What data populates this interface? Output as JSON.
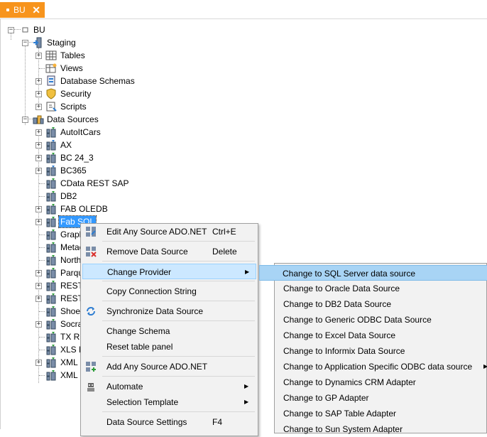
{
  "tab": {
    "label": "BU",
    "close": "✕",
    "color": "#f7941d"
  },
  "tree": {
    "root": "BU",
    "staging": {
      "label": "Staging",
      "children": [
        "Tables",
        "Views",
        "Database Schemas",
        "Security",
        "Scripts"
      ]
    },
    "datasources": {
      "label": "Data Sources",
      "children": [
        "AutoItCars",
        "AX",
        "BC 24_3",
        "BC365",
        "CData REST SAP",
        "DB2",
        "FAB OLEDB",
        "Fab SQL",
        "Graph",
        "Metac",
        "Northw",
        "Parqu",
        "REST",
        "REST",
        "Shoes",
        "Socra",
        "TX RE",
        "XLS F",
        "XML C",
        "XML F"
      ],
      "selected": "Fab SQL"
    }
  },
  "menu": {
    "edit": {
      "label": "Edit Any Source ADO.NET",
      "shortcut": "Ctrl+E"
    },
    "remove": {
      "label": "Remove Data Source",
      "shortcut": "Delete"
    },
    "change_provider": {
      "label": "Change Provider"
    },
    "copy": {
      "label": "Copy Connection String"
    },
    "sync": {
      "label": "Synchronize Data Source"
    },
    "schema": {
      "label": "Change Schema"
    },
    "reset": {
      "label": "Reset table panel"
    },
    "add": {
      "label": "Add Any Source ADO.NET"
    },
    "automate": {
      "label": "Automate"
    },
    "template": {
      "label": "Selection Template"
    },
    "settings": {
      "label": "Data Source Settings",
      "shortcut": "F4"
    }
  },
  "submenu": {
    "items": [
      "Change to SQL Server data source",
      "Change to Oracle Data Source",
      "Change to DB2 Data Source",
      "Change to Generic ODBC Data Source",
      "Change to Excel Data Source",
      "Change to Informix Data Source",
      "Change to Application Specific ODBC data source",
      "Change to Dynamics CRM Adapter",
      "Change to GP Adapter",
      "Change to SAP Table Adapter",
      "Change to Sun System Adapter"
    ]
  },
  "colors": {
    "selection": "#3399ff",
    "menu_highlight": "#cce8ff",
    "submenu_highlight": "#a8d4f5"
  }
}
